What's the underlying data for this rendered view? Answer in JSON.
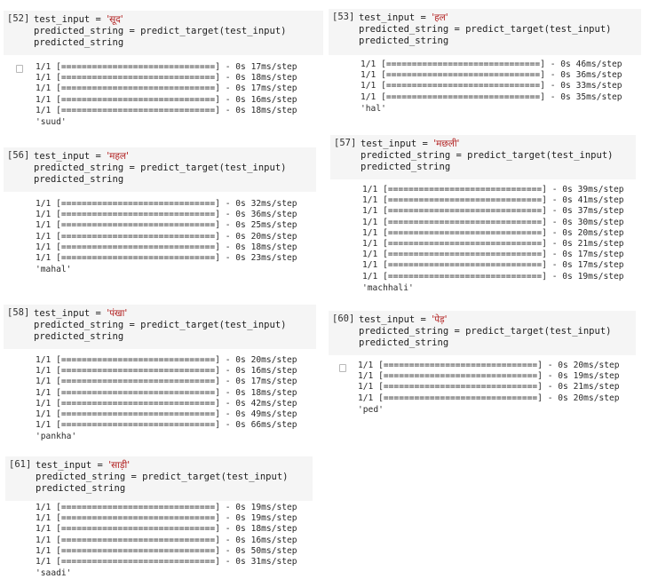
{
  "cells": [
    {
      "id": "c52",
      "prompt": "[52]",
      "input_var": "test_input",
      "input_word": "'सूद'",
      "line2": "predicted_string = predict_target(test_input)",
      "line3": "predicted_string",
      "output_icon": true,
      "steps": [
        "1/1 [==============================] - 0s 17ms/step",
        "1/1 [==============================] - 0s 18ms/step",
        "1/1 [==============================] - 0s 17ms/step",
        "1/1 [==============================] - 0s 16ms/step",
        "1/1 [==============================] - 0s 18ms/step"
      ],
      "result": "'suud'"
    },
    {
      "id": "c53",
      "prompt": "[53]",
      "input_var": "test_input",
      "input_word": "'हल'",
      "line2": "predicted_string = predict_target(test_input)",
      "line3": "predicted_string",
      "output_icon": false,
      "steps": [
        "1/1 [==============================] - 0s 46ms/step",
        "1/1 [==============================] - 0s 36ms/step",
        "1/1 [==============================] - 0s 33ms/step",
        "1/1 [==============================] - 0s 35ms/step"
      ],
      "result": "'hal'"
    },
    {
      "id": "c56",
      "prompt": "[56]",
      "input_var": "test_input",
      "input_word": "'महल'",
      "line2": "predicted_string = predict_target(test_input)",
      "line3": "predicted_string",
      "output_icon": false,
      "steps": [
        "1/1 [==============================] - 0s 32ms/step",
        "1/1 [==============================] - 0s 36ms/step",
        "1/1 [==============================] - 0s 25ms/step",
        "1/1 [==============================] - 0s 20ms/step",
        "1/1 [==============================] - 0s 18ms/step",
        "1/1 [==============================] - 0s 23ms/step"
      ],
      "result": "'mahal'"
    },
    {
      "id": "c57",
      "prompt": "[57]",
      "input_var": "test_input",
      "input_word": "'मछली'",
      "line2": "predicted_string = predict_target(test_input)",
      "line3": "predicted_string",
      "output_icon": false,
      "steps": [
        "1/1 [==============================] - 0s 39ms/step",
        "1/1 [==============================] - 0s 41ms/step",
        "1/1 [==============================] - 0s 37ms/step",
        "1/1 [==============================] - 0s 30ms/step",
        "1/1 [==============================] - 0s 20ms/step",
        "1/1 [==============================] - 0s 21ms/step",
        "1/1 [==============================] - 0s 17ms/step",
        "1/1 [==============================] - 0s 17ms/step",
        "1/1 [==============================] - 0s 19ms/step"
      ],
      "result": "'machhali'"
    },
    {
      "id": "c58",
      "prompt": "[58]",
      "input_var": "test_input",
      "input_word": "'पंखा'",
      "line2": "predicted_string = predict_target(test_input)",
      "line3": "predicted_string",
      "output_icon": false,
      "steps": [
        "1/1 [==============================] - 0s 20ms/step",
        "1/1 [==============================] - 0s 16ms/step",
        "1/1 [==============================] - 0s 17ms/step",
        "1/1 [==============================] - 0s 18ms/step",
        "1/1 [==============================] - 0s 42ms/step",
        "1/1 [==============================] - 0s 49ms/step",
        "1/1 [==============================] - 0s 66ms/step"
      ],
      "result": "'pankha'"
    },
    {
      "id": "c60",
      "prompt": "[60]",
      "input_var": "test_input",
      "input_word": "'पेड़'",
      "line2": "predicted_string = predict_target(test_input)",
      "line3": "predicted_string",
      "output_icon": true,
      "steps": [
        "1/1 [==============================] - 0s 20ms/step",
        "1/1 [==============================] - 0s 19ms/step",
        "1/1 [==============================] - 0s 21ms/step",
        "1/1 [==============================] - 0s 20ms/step"
      ],
      "result": "'ped'"
    },
    {
      "id": "c61",
      "prompt": "[61]",
      "input_var": "test_input",
      "input_word": "'साड़ी'",
      "line2": "predicted_string = predict_target(test_input)",
      "line3": "predicted_string",
      "output_icon": false,
      "steps": [
        "1/1 [==============================] - 0s 19ms/step",
        "1/1 [==============================] - 0s 19ms/step",
        "1/1 [==============================] - 0s 18ms/step",
        "1/1 [==============================] - 0s 16ms/step",
        "1/1 [==============================] - 0s 50ms/step",
        "1/1 [==============================] - 0s 31ms/step"
      ],
      "result": "'saadi'"
    }
  ]
}
